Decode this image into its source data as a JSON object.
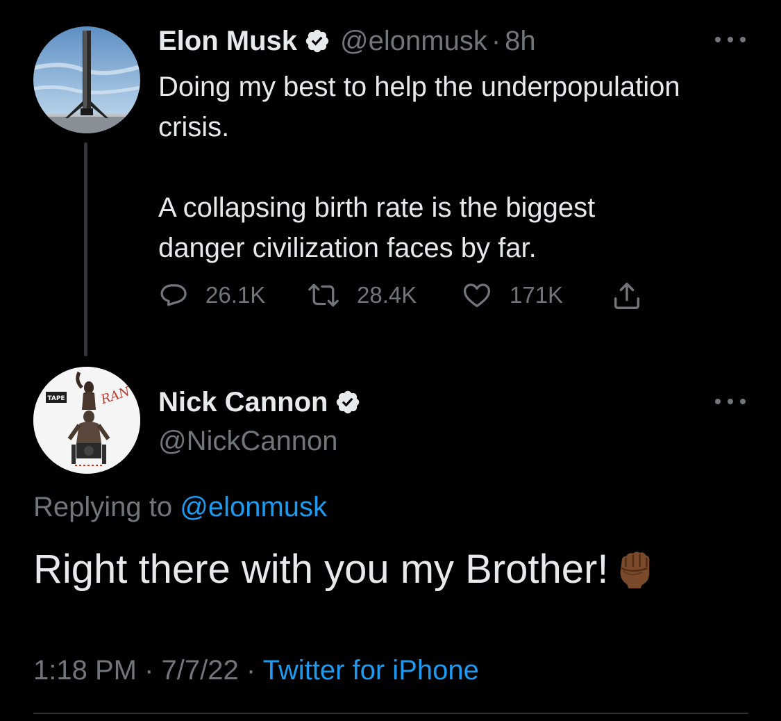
{
  "parent_tweet": {
    "display_name": "Elon Musk",
    "handle": "@elonmusk",
    "separator": "·",
    "time": "8h",
    "paragraphs": [
      "Doing my best to help the underpopulation crisis.",
      "A collapsing birth rate is the biggest danger civilization faces by far."
    ],
    "stats": {
      "replies": "26.1K",
      "retweets": "28.4K",
      "likes": "171K"
    }
  },
  "reply_tweet": {
    "display_name": "Nick Cannon",
    "handle": "@NickCannon",
    "replying_prefix": "Replying to",
    "replying_handle": "@elonmusk",
    "body": "Right there with you my Brother!",
    "emoji": "raised-fist-medium-dark-skin-tone",
    "time": "1:18 PM",
    "separator": "·",
    "date": "7/7/22",
    "source": "Twitter for iPhone",
    "avatar_text": {
      "top_left": "TAPE",
      "signature": "RAN"
    }
  },
  "icons": {
    "verified": "verified-badge-icon",
    "reply": "reply-icon",
    "retweet": "retweet-icon",
    "like": "heart-icon",
    "share": "share-icon",
    "more": "more-icon"
  },
  "colors": {
    "background": "#000000",
    "primary_text": "#e7e9ea",
    "secondary_text": "#71767b",
    "link": "#1d9bf0",
    "divider": "#2f3336"
  }
}
